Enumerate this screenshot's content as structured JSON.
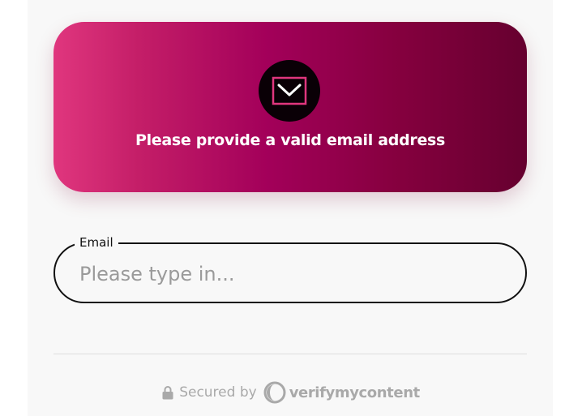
{
  "banner": {
    "icon": "envelope-icon",
    "message": "Please provide a valid email address",
    "gradient_colors": [
      "#e0367e",
      "#a3005a",
      "#66002f"
    ]
  },
  "email_field": {
    "label": "Email",
    "placeholder": "Please type in...",
    "value": ""
  },
  "footer": {
    "icon": "lock-icon",
    "secured_text": "Secured by",
    "brand_icon": "verifymycontent-logo-icon",
    "brand_name": "verifymycontent"
  }
}
